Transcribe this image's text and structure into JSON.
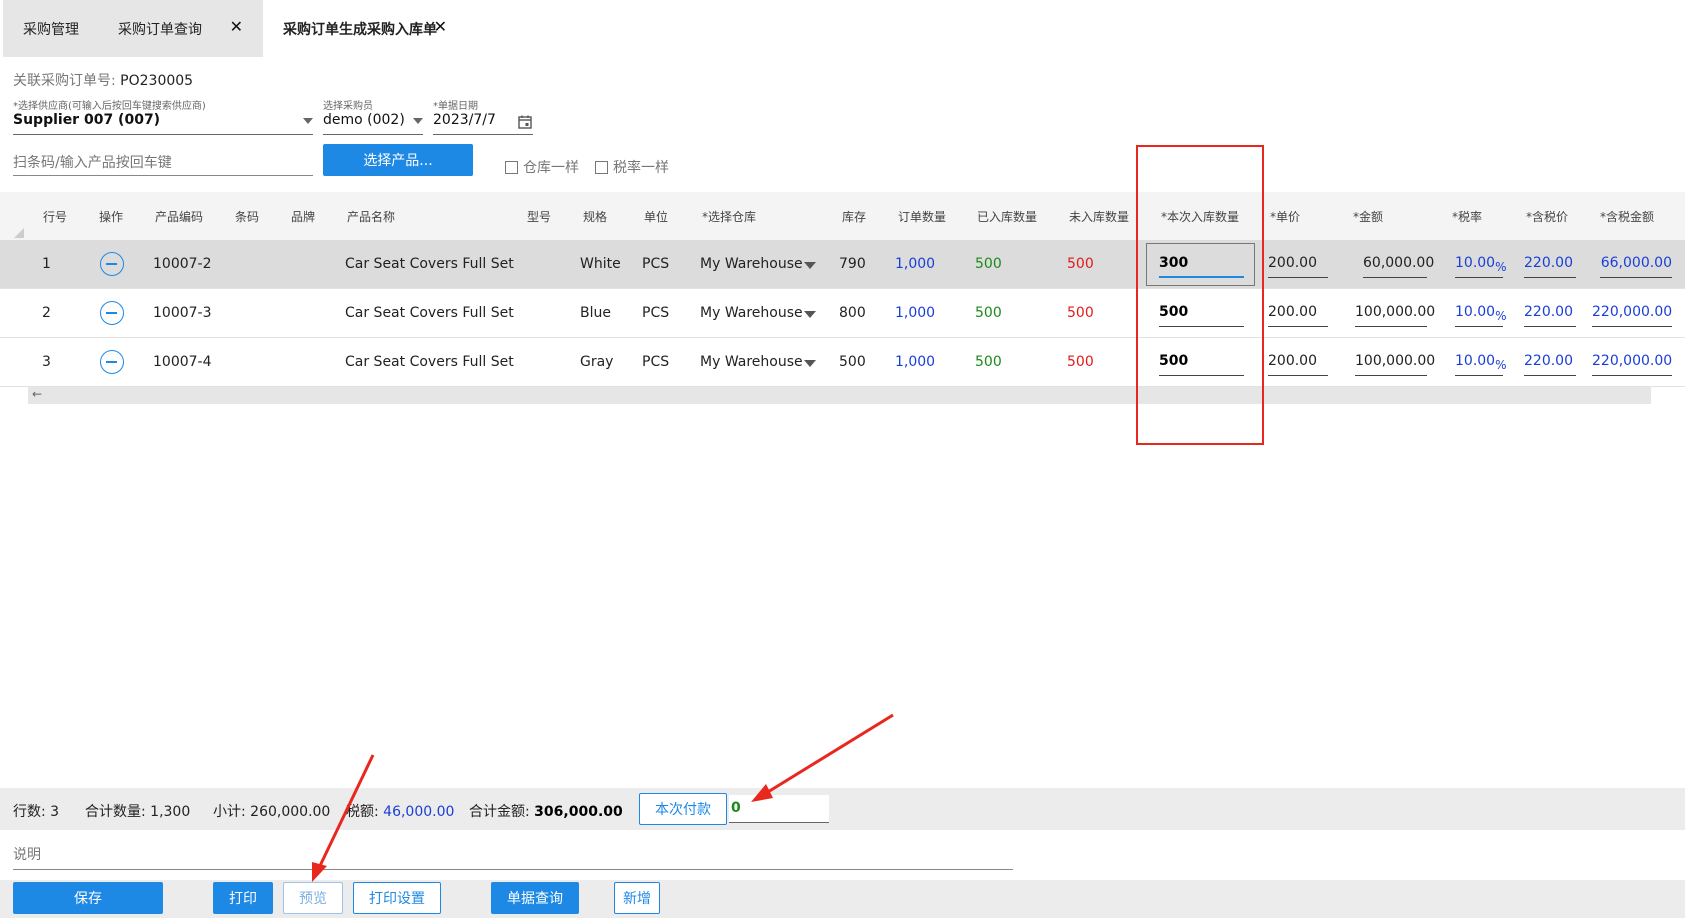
{
  "tabs": [
    {
      "label": "采购管理"
    },
    {
      "label": "采购订单查询"
    },
    {
      "label": "采购订单生成采购入库单"
    }
  ],
  "header": {
    "ref_label": "关联采购订单号: ",
    "ref_value": "PO230005",
    "supplier_label": "*选择供应商(可输入后按回车键搜索供应商)",
    "supplier_value": "Supplier 007 (007)",
    "buyer_label": "选择采购员",
    "buyer_value": "demo (002)",
    "date_label": "*单据日期",
    "date_value": "2023/7/7",
    "scan_placeholder": "扫条码/输入产品按回车键",
    "select_product_label": "选择产品...",
    "same_warehouse_label": "仓库一样",
    "same_tax_label": "税率一样"
  },
  "columns": [
    "行号",
    "操作",
    "产品编码",
    "条码",
    "品牌",
    "产品名称",
    "型号",
    "规格",
    "单位",
    "*选择仓库",
    "库存",
    "订单数量",
    "已入库数量",
    "未入库数量",
    "*本次入库数量",
    "*单价",
    "*金额",
    "*税率",
    "*含税价",
    "*含税金额"
  ],
  "rows": [
    {
      "no": "1",
      "code": "10007-2",
      "name": "Car Seat Covers Full Set",
      "spec": "White",
      "unit": "PCS",
      "warehouse": "My Warehouse",
      "stock": "790",
      "order_qty": "1,000",
      "received": "500",
      "pending": "500",
      "qty": "300",
      "price": "200.00",
      "amount": "60,000.00",
      "tax": "10.00",
      "tax_price": "220.00",
      "tax_amount": "66,000.00"
    },
    {
      "no": "2",
      "code": "10007-3",
      "name": "Car Seat Covers Full Set",
      "spec": "Blue",
      "unit": "PCS",
      "warehouse": "My Warehouse",
      "stock": "800",
      "order_qty": "1,000",
      "received": "500",
      "pending": "500",
      "qty": "500",
      "price": "200.00",
      "amount": "100,000.00",
      "tax": "10.00",
      "tax_price": "220.00",
      "tax_amount": "220,000.00"
    },
    {
      "no": "3",
      "code": "10007-4",
      "name": "Car Seat Covers Full Set",
      "spec": "Gray",
      "unit": "PCS",
      "warehouse": "My Warehouse",
      "stock": "500",
      "order_qty": "1,000",
      "received": "500",
      "pending": "500",
      "qty": "500",
      "price": "200.00",
      "amount": "100,000.00",
      "tax": "10.00",
      "tax_price": "220.00",
      "tax_amount": "220,000.00"
    }
  ],
  "percent_sign": "%",
  "scroll_left_glyph": "←",
  "summary": {
    "rows_label": "行数: ",
    "rows_value": "3",
    "total_qty_label": "合计数量: ",
    "total_qty_value": "1,300",
    "subtotal_label": "小计: ",
    "subtotal_value": "260,000.00",
    "tax_label": "税额: ",
    "tax_value": "46,000.00",
    "total_label": "合计金额: ",
    "total_value": "306,000.00",
    "pay_button": "本次付款",
    "pay_value": "0"
  },
  "remark_placeholder": "说明",
  "actions": {
    "save": "保存",
    "print": "打印",
    "preview": "预览",
    "print_settings": "打印设置",
    "doc_query": "单据查询",
    "new": "新增"
  },
  "colors": {
    "primary": "#1e88e5",
    "link_blue": "#1a3fd6",
    "green": "#1a8a1a",
    "red": "#e01b1b",
    "annotation": "#e8271e"
  }
}
